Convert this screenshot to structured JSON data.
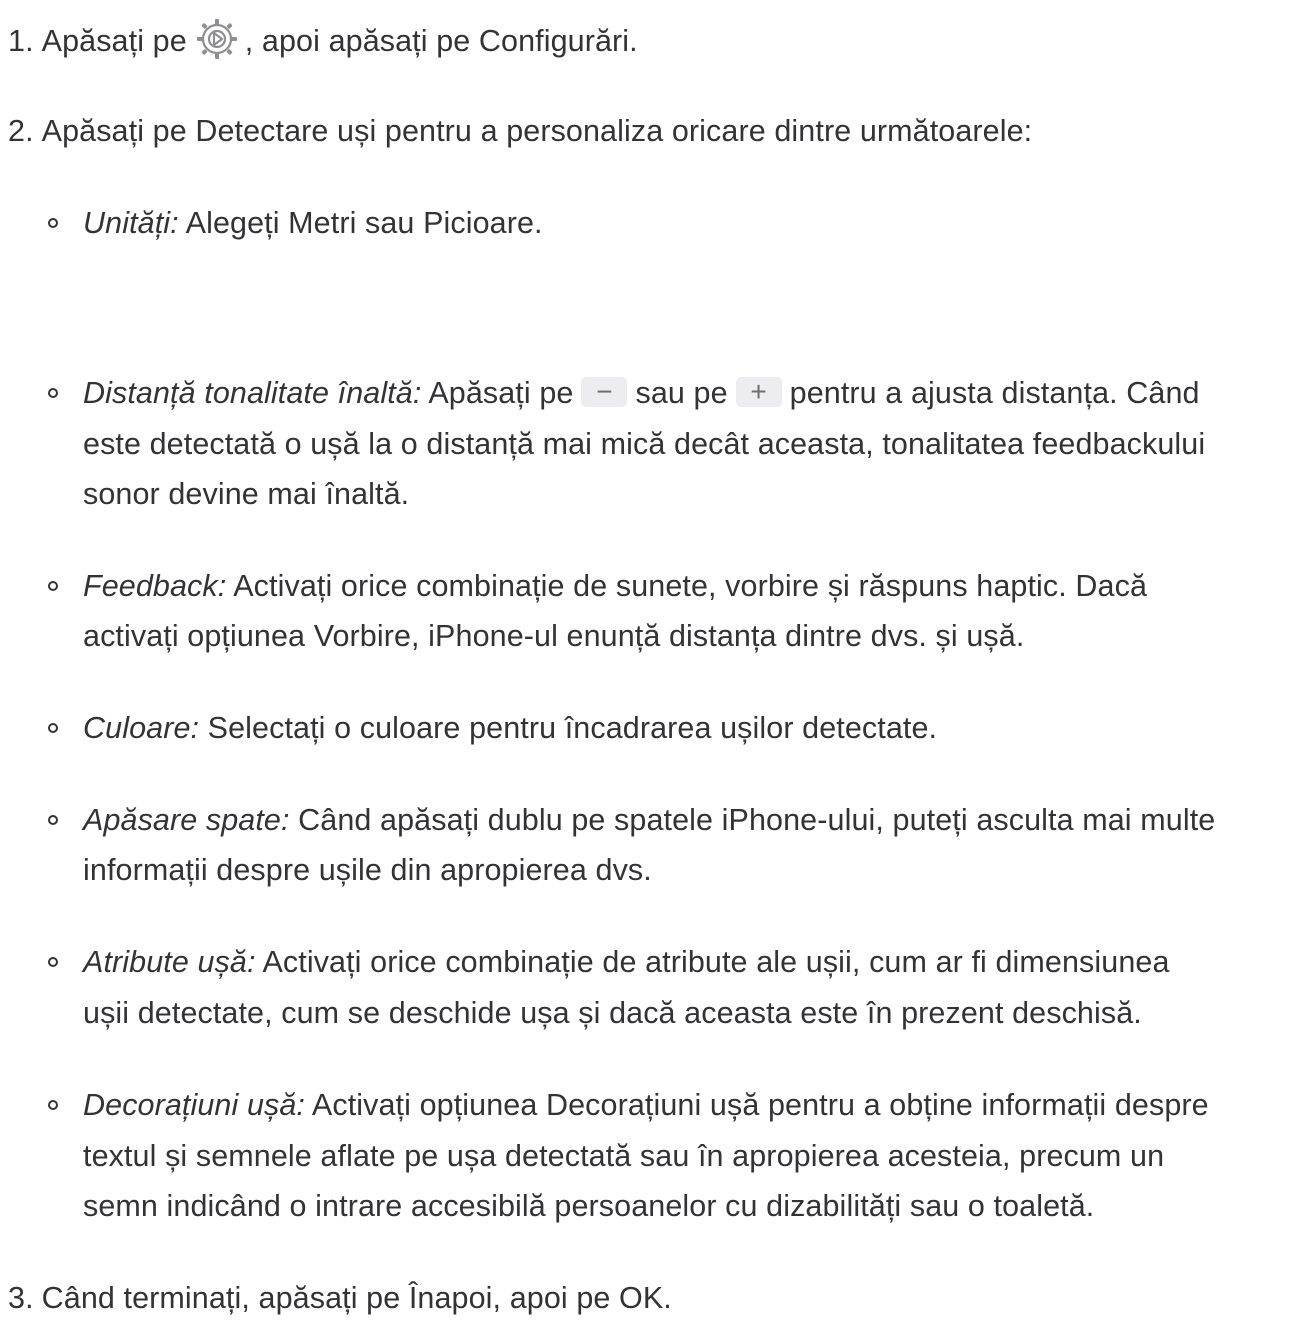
{
  "step1": {
    "number": "1.",
    "before": "Apăsați pe",
    "icon": "settings-gear-icon",
    "after": ", apoi apăsați pe Configurări."
  },
  "step2": {
    "number": "2.",
    "text": "Apăsați pe Detectare uși pentru a personaliza oricare dintre următoarele:"
  },
  "units": {
    "term": "Unități:",
    "text": "Alegeți Metri sau Picioare."
  },
  "pitch": {
    "term": "Distanță tonalitate înaltă:",
    "before": "Apăsați pe",
    "minus_label": "−",
    "middle": "sau pe",
    "plus_label": "+",
    "after": "pentru a ajusta distanța. Când",
    "line2": "este detectată o ușă la o distanță mai mică decât aceasta, tonalitatea feedbackului",
    "line3": "sonor devine mai înaltă."
  },
  "feedback": {
    "term": "Feedback:",
    "line1": "Activați orice combinație de sunete, vorbire și răspuns haptic. Dacă",
    "line2": "activați opțiunea Vorbire, iPhone-ul enunță distanța dintre dvs. și ușă."
  },
  "color": {
    "term": "Culoare:",
    "text": "Selectați o culoare pentru încadrarea ușilor detectate."
  },
  "backtap": {
    "term": "Apăsare spate:",
    "line1": "Când apăsați dublu pe spatele iPhone-ului, puteți asculta mai multe",
    "line2": "informații despre ușile din apropierea dvs."
  },
  "attributes": {
    "term": "Atribute ușă:",
    "line1": "Activați orice combinație de atribute ale ușii, cum ar fi dimensiunea",
    "line2": "ușii detectate, cum se deschide ușa și dacă aceasta este în prezent deschisă."
  },
  "decorations": {
    "term": "Decorațiuni ușă:",
    "line1": "Activați opțiunea Decorațiuni ușă pentru a obține informații despre",
    "line2": "textul și semnele aflate pe ușa detectată sau în apropierea acesteia, precum un",
    "line3": "semn indicând o intrare accesibilă persoanelor cu dizabilități sau o toaletă."
  },
  "step3": {
    "number": "3.",
    "text": "Când terminați, apăsați pe Înapoi, apoi pe OK."
  }
}
